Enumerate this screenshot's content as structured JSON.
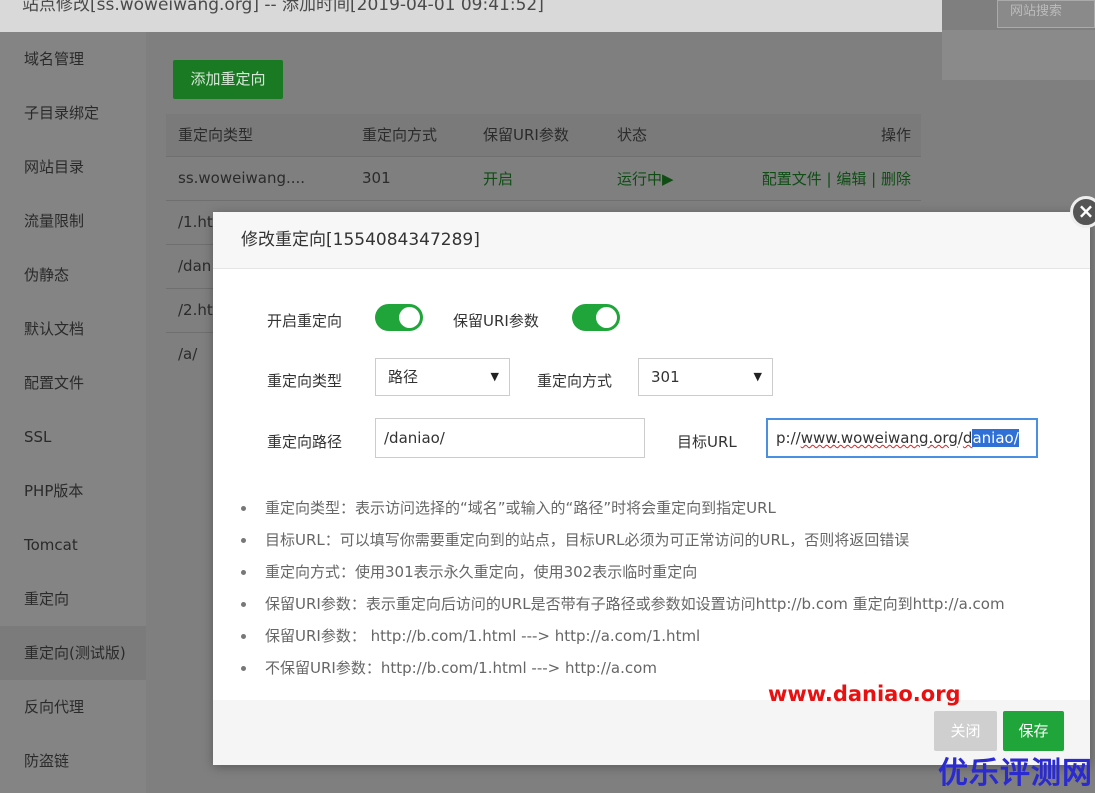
{
  "window": {
    "title": "站点修改[ss.woweiwang.org] -- 添加时间[2019-04-01 09:41:52]"
  },
  "right_panel": {
    "search_label": "网站搜索"
  },
  "sidebar": {
    "items": [
      {
        "label": "域名管理"
      },
      {
        "label": "子目录绑定"
      },
      {
        "label": "网站目录"
      },
      {
        "label": "流量限制"
      },
      {
        "label": "伪静态"
      },
      {
        "label": "默认文档"
      },
      {
        "label": "配置文件"
      },
      {
        "label": "SSL"
      },
      {
        "label": "PHP版本"
      },
      {
        "label": "Tomcat"
      },
      {
        "label": "重定向"
      },
      {
        "label": "重定向(测试版)"
      },
      {
        "label": "反向代理"
      },
      {
        "label": "防盗链"
      }
    ]
  },
  "main": {
    "add_button": "添加重定向",
    "table": {
      "headers": [
        "重定向类型",
        "重定向方式",
        "保留URI参数",
        "状态",
        "操作"
      ],
      "rows": [
        {
          "type": "ss.woweiwang....",
          "method": "301",
          "keep": "开启",
          "status": "运行中▶",
          "actions": [
            "配置文件",
            "编辑",
            "删除"
          ]
        },
        {
          "type": "/1.ht"
        },
        {
          "type": "/dan"
        },
        {
          "type": "/2.ht"
        },
        {
          "type": "/a/"
        }
      ],
      "sep": "|"
    }
  },
  "modal": {
    "title": "修改重定向[1554084347289]",
    "enable_label": "开启重定向",
    "keep_uri_label": "保留URI参数",
    "type_label": "重定向类型",
    "type_value": "路径",
    "method_label": "重定向方式",
    "method_value": "301",
    "path_label": "重定向路径",
    "path_value": "/daniao/",
    "target_label": "目标URL",
    "target_value": {
      "prefix": "p://",
      "domain": "www.woweiwang.org",
      "slash": "/",
      "d": "d",
      "selected": "aniao/"
    },
    "tips": [
      "重定向类型：表示访问选择的“域名”或输入的“路径”时将会重定向到指定URL",
      "目标URL：可以填写你需要重定向到的站点，目标URL必须为可正常访问的URL，否则将返回错误",
      "重定向方式：使用301表示永久重定向，使用302表示临时重定向",
      "保留URI参数：表示重定向后访问的URL是否带有子路径或参数如设置访问http://b.com 重定向到http://a.com",
      "保留URI参数：  http://b.com/1.html ---> http://a.com/1.html",
      "不保留URI参数：http://b.com/1.html ---> http://a.com"
    ],
    "close_button": "关闭",
    "save_button": "保存"
  },
  "watermarks": {
    "site": "www.daniao.org",
    "brand": "优乐评测网"
  },
  "colors": {
    "accent_green": "#20a53a",
    "focus_blue": "#4a90e2",
    "watermark_red": "#e81010",
    "watermark_blue": "#2a2ad0"
  }
}
